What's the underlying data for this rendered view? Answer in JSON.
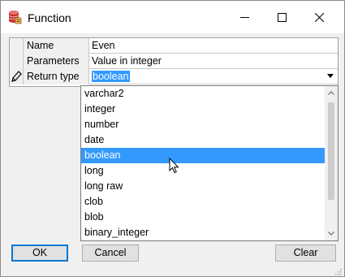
{
  "window": {
    "title": "Function"
  },
  "grid": {
    "rows": [
      {
        "name": "Name",
        "value": "Even"
      },
      {
        "name": "Parameters",
        "value": "Value in integer"
      },
      {
        "name": "Return type",
        "value": "boolean"
      }
    ]
  },
  "dropdown": {
    "options": [
      "varchar2",
      "integer",
      "number",
      "date",
      "boolean",
      "long",
      "long raw",
      "clob",
      "blob",
      "binary_integer"
    ],
    "selected": "boolean"
  },
  "buttons": {
    "ok": "OK",
    "cancel": "Cancel",
    "clear": "Clear"
  },
  "colors": {
    "selection": "#3399ff",
    "window_bg": "#f0f0f0"
  }
}
